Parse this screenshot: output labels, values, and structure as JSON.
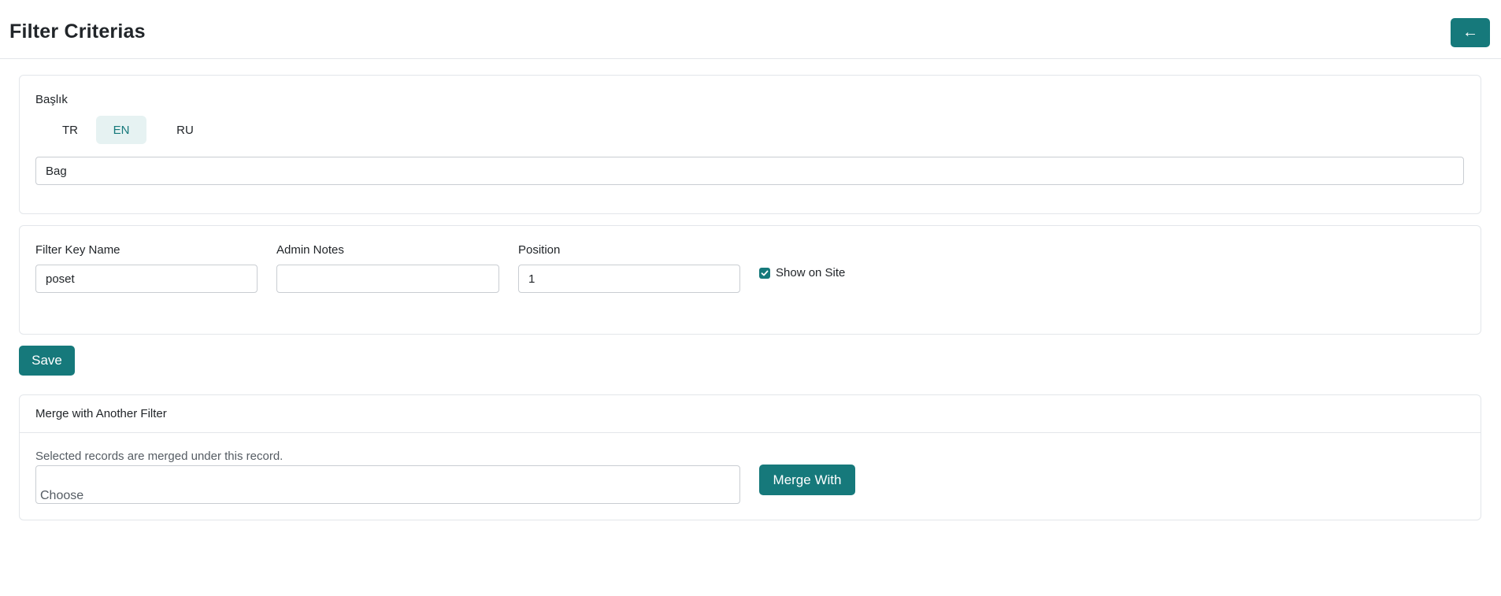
{
  "header": {
    "title": "Filter Criterias",
    "back_icon": "←"
  },
  "title_section": {
    "label": "Başlık",
    "tabs": [
      "TR",
      "EN",
      "RU"
    ],
    "active_tab": "EN",
    "value": "Bag"
  },
  "fields": {
    "filter_key_label": "Filter Key Name",
    "filter_key_value": "poset",
    "admin_notes_label": "Admin Notes",
    "admin_notes_value": "",
    "position_label": "Position",
    "position_value": "1",
    "show_on_site_label": "Show on Site",
    "show_on_site_checked": true
  },
  "save_label": "Save",
  "merge": {
    "heading": "Merge with Another Filter",
    "help_text": "Selected records are merged under this record.",
    "select_placeholder": "Choose",
    "button_label": "Merge With"
  },
  "colors": {
    "accent": "#16797b",
    "tab_active_bg": "#e6f2f2"
  }
}
